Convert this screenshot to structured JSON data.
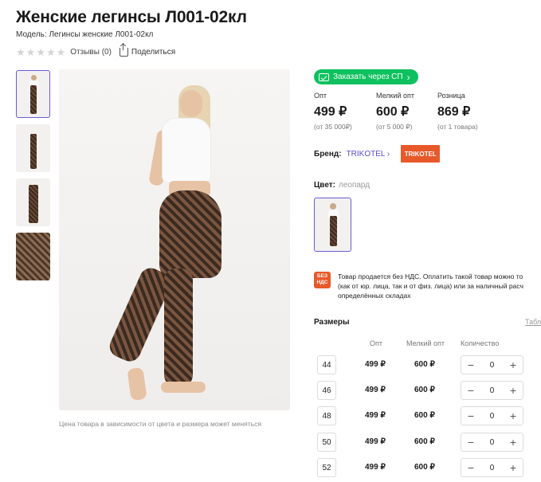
{
  "product": {
    "title": "Женские легинсы Л001-02кл",
    "model": "Модель: Легинсы женские Л001-02кл",
    "rating_stars": 0,
    "reviews": "Отзывы (0)",
    "share": "Поделиться"
  },
  "photo_caption": "Цена товара в зависимости от цвета и размера может меняться",
  "order_button": "Заказать через СП",
  "prices": [
    {
      "label": "Опт",
      "value": "499 ₽",
      "note": "(от 35 000₽)"
    },
    {
      "label": "Мелкий опт",
      "value": "600 ₽",
      "note": "(от 5 000 ₽)"
    },
    {
      "label": "Розница",
      "value": "869 ₽",
      "note": "(от 1 товара)"
    }
  ],
  "brand": {
    "label": "Бренд:",
    "name": "TRIKOTEL",
    "logo_text": "TRIKOTEL"
  },
  "color": {
    "label": "Цвет:",
    "value": "леопард"
  },
  "vat": {
    "badge": "БЕЗ НДС",
    "text": "Товар продается без НДС. Оплатить такой товар можно то\n(как от юр. лица, так и от физ. лица) или за наличный расч\nопределённых складах"
  },
  "sizes": {
    "title": "Размеры",
    "table_link": "Табл",
    "headers": {
      "opt": "Опт",
      "small_opt": "Мелкий опт",
      "qty": "Количество"
    },
    "rows": [
      {
        "size": "44",
        "opt": "499 ₽",
        "small_opt": "600 ₽",
        "qty": "0"
      },
      {
        "size": "46",
        "opt": "499 ₽",
        "small_opt": "600 ₽",
        "qty": "0"
      },
      {
        "size": "48",
        "opt": "499 ₽",
        "small_opt": "600 ₽",
        "qty": "0"
      },
      {
        "size": "50",
        "opt": "499 ₽",
        "small_opt": "600 ₽",
        "qty": "0"
      },
      {
        "size": "52",
        "opt": "499 ₽",
        "small_opt": "600 ₽",
        "qty": "0"
      }
    ]
  },
  "colors": {
    "accent": "#6b5bd6",
    "order_green": "#0ec15f",
    "brand_orange": "#e8592a"
  }
}
